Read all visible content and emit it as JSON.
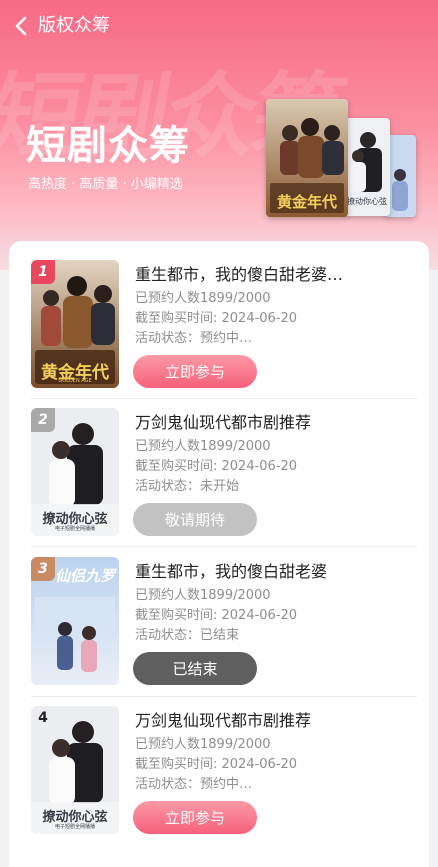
{
  "header": {
    "title": "版权众筹"
  },
  "hero": {
    "title": "短剧众筹",
    "subtitle": "高热度 · 高质量 · 小编精选",
    "watermark": "短剧众筹"
  },
  "posters": {
    "golden_era": {
      "title": "黄金年代",
      "caption": "GOLDEN AGE"
    },
    "heart_string": {
      "title": "撩动你心弦",
      "caption": "电子短剧全网播播"
    },
    "fairy": {
      "title": "仙侣九罗"
    }
  },
  "items": [
    {
      "rank": "1",
      "title": "重生都市，我的傻白甜老婆…",
      "reserved": "已预约人数1899/2000",
      "deadline": "截至购买时间:  2024-06-20",
      "status": "活动状态：预约中…",
      "button": "立即参与",
      "rank_color": "#e8475f"
    },
    {
      "rank": "2",
      "title": "万剑鬼仙现代都市剧推荐",
      "reserved": "已预约人数1899/2000",
      "deadline": "截至购买时间:  2024-06-20",
      "status": "活动状态：未开始",
      "button": "敬请期待",
      "rank_color": "#a9a9a9"
    },
    {
      "rank": "3",
      "title": "重生都市，我的傻白甜老婆",
      "reserved": "已预约人数1899/2000",
      "deadline": "截至购买时间:  2024-06-20",
      "status": "活动状态：已结束",
      "button": "已结束",
      "rank_color": "#c98b63"
    },
    {
      "rank": "4",
      "title": "万剑鬼仙现代都市剧推荐",
      "reserved": "已预约人数1899/2000",
      "deadline": "截至购买时间:  2024-06-20",
      "status": "活动状态：预约中…",
      "button": "立即参与",
      "rank_color": "transparent"
    }
  ],
  "colors": {
    "accent_pink": "#f5607a",
    "disabled_gray": "#c2c2c2",
    "ended_dark": "#5f5f5f"
  }
}
